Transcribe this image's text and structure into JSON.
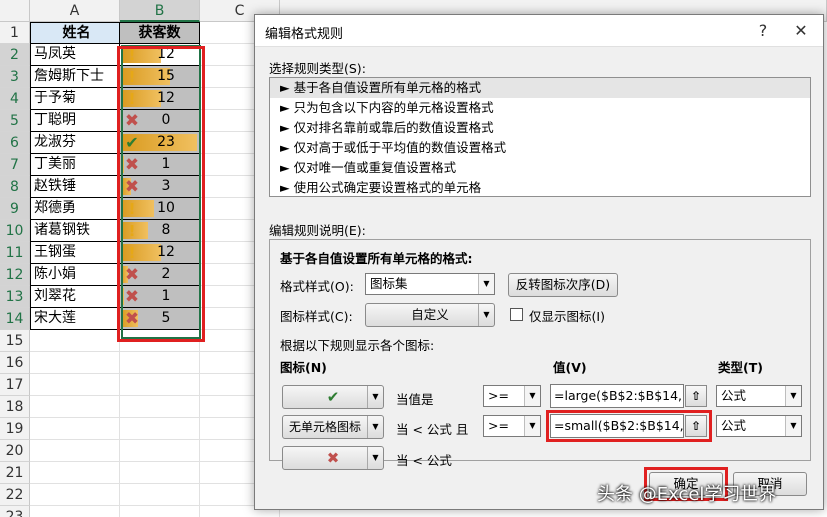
{
  "sheet": {
    "columns": [
      "A",
      "B",
      "C"
    ],
    "rows": [
      "1",
      "2",
      "3",
      "4",
      "5",
      "6",
      "7",
      "8",
      "9",
      "10",
      "11",
      "12",
      "13",
      "14",
      "15",
      "16",
      "17",
      "18",
      "19",
      "20",
      "21",
      "22",
      "23"
    ],
    "header_name": "姓名",
    "header_count": "获客数",
    "records": [
      {
        "name": "马凤英",
        "value": "12",
        "icon": "exclamation",
        "bar": 0.52
      },
      {
        "name": "詹姆斯下士",
        "value": "15",
        "icon": "exclamation",
        "bar": 0.65
      },
      {
        "name": "于予菊",
        "value": "12",
        "icon": "exclamation",
        "bar": 0.52
      },
      {
        "name": "丁聪明",
        "value": "0",
        "icon": "cross",
        "bar": 0.0
      },
      {
        "name": "龙淑芬",
        "value": "23",
        "icon": "check",
        "bar": 1.0
      },
      {
        "name": "丁美丽",
        "value": "1",
        "icon": "cross",
        "bar": 0.04
      },
      {
        "name": "赵铁锤",
        "value": "3",
        "icon": "cross",
        "bar": 0.13
      },
      {
        "name": "郑德勇",
        "value": "10",
        "icon": "exclamation",
        "bar": 0.43
      },
      {
        "name": "诸葛钢铁",
        "value": "8",
        "icon": "exclamation",
        "bar": 0.35
      },
      {
        "name": "王钢蛋",
        "value": "12",
        "icon": "exclamation",
        "bar": 0.52
      },
      {
        "name": "陈小娟",
        "value": "2",
        "icon": "cross",
        "bar": 0.09
      },
      {
        "name": "刘翠花",
        "value": "1",
        "icon": "cross",
        "bar": 0.04
      },
      {
        "name": "宋大莲",
        "value": "5",
        "icon": "cross",
        "bar": 0.22
      }
    ]
  },
  "dialog": {
    "title": "编辑格式规则",
    "help": "?",
    "close": "✕",
    "select_type_label": "选择规则类型(S):",
    "rule_types": [
      "► 基于各自值设置所有单元格的格式",
      "► 只为包含以下内容的单元格设置格式",
      "► 仅对排名靠前或靠后的数值设置格式",
      "► 仅对高于或低于平均值的数值设置格式",
      "► 仅对唯一值或重复值设置格式",
      "► 使用公式确定要设置格式的单元格"
    ],
    "edit_desc_label": "编辑规则说明(E):",
    "desc_heading": "基于各自值设置所有单元格的格式:",
    "format_style_label": "格式样式(O):",
    "format_style_value": "图标集",
    "reverse_button": "反转图标次序(D)",
    "icon_style_label": "图标样式(C):",
    "icon_style_value": "自定义",
    "show_icon_only": "仅显示图标(I)",
    "rule_text": "根据以下规则显示各个图标:",
    "col_icon": "图标(N)",
    "col_value": "值(V)",
    "col_type": "类型(T)",
    "rows": [
      {
        "icon_text": "✔",
        "condition": "当值是",
        "operator": ">=",
        "value": "=large($B$2:$B$14,1)",
        "type": "公式"
      },
      {
        "icon_text": "无单元格图标",
        "condition": "当 < 公式 且",
        "operator": ">=",
        "value": "=small($B$2:$B$14,2)",
        "type": "公式"
      },
      {
        "icon_text": "✖",
        "condition": "当 < 公式"
      }
    ],
    "ok": "确定",
    "cancel": "取消"
  },
  "watermark": "头条 @Excel学习世界",
  "colors": {
    "accent_red": "#e02020",
    "bar_gold": "#d99a1f",
    "excel_green": "#217346"
  }
}
